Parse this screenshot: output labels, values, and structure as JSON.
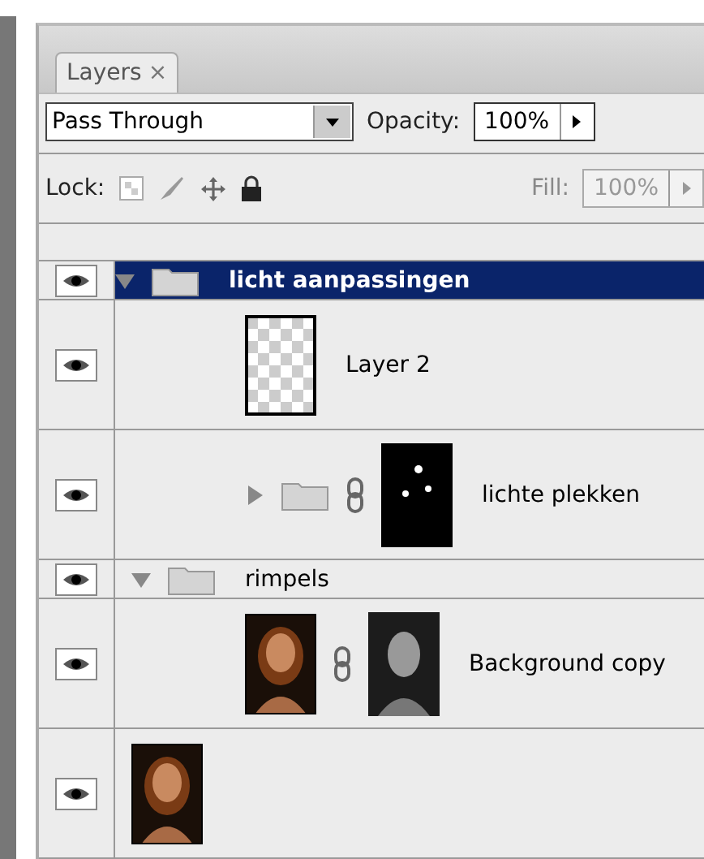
{
  "tab": {
    "label": "Layers",
    "close": "×",
    "selected": true
  },
  "blend": {
    "value": "Pass Through"
  },
  "opacity": {
    "label": "Opacity:",
    "value": "100%"
  },
  "lock": {
    "label": "Lock:"
  },
  "fill": {
    "label": "Fill:",
    "value": "100%",
    "disabled": true
  },
  "layers": [
    {
      "kind": "group",
      "name": "licht aanpassingen",
      "visible": true,
      "selected": true,
      "expanded": true,
      "children": [
        {
          "kind": "layer",
          "name": "Layer 2",
          "visible": true,
          "selected": false,
          "thumbnail": {
            "kind": "transparent"
          }
        },
        {
          "kind": "group",
          "name": "lichte plekken",
          "visible": true,
          "selected": false,
          "expanded": false,
          "mask": {
            "kind": "spots"
          }
        }
      ]
    },
    {
      "kind": "group",
      "name": "rimpels",
      "visible": true,
      "selected": false,
      "expanded": true,
      "children": [
        {
          "kind": "layer",
          "name": "Background copy",
          "visible": true,
          "selected": false,
          "mask": {
            "kind": "portrait"
          }
        }
      ]
    },
    {
      "kind": "layer",
      "visible": true,
      "selected": false
    }
  ]
}
